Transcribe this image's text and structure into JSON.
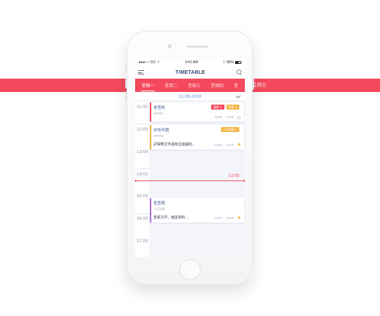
{
  "status": {
    "carrier": "●●●○○ GS",
    "time": "9:41 AM",
    "battery": "58%"
  },
  "header": {
    "title": "TIMETABLE"
  },
  "tabs": [
    {
      "label": "星期一",
      "active": true
    },
    {
      "label": "星期二",
      "active": false
    },
    {
      "label": "星期三",
      "active": false
    },
    {
      "label": "星期四",
      "active": false
    },
    {
      "label": "星",
      "active": false
    }
  ],
  "date": "11.06.2018",
  "hours": [
    "11:00",
    "12:00",
    "13:00",
    "14:00",
    "15:00",
    "16:00",
    "17:00"
  ],
  "now": "13:50",
  "cards": [
    {
      "title": "會查財",
      "subtitle": "台中市9",
      "badges": [
        {
          "label": "重要 ✕",
          "color": "#f4495c"
        },
        {
          "label": "待辦 ✕",
          "color": "#f3b43f"
        }
      ],
      "note": "",
      "time": "11:00 → 11:50",
      "marker": "circle",
      "accent": "#f4495c"
    },
    {
      "title": "去吃中國",
      "subtitle": "台中市9",
      "badges": [
        {
          "label": "公司會議 ✕",
          "color": "#f3b43f"
        }
      ],
      "note": "記得幫文件還有拉遊戲的...",
      "time": "12:00 → 13:10",
      "marker": "star",
      "accent": "#f3b43f"
    },
    {
      "title": "查查頭",
      "subtitle": "六巧文館",
      "badges": [],
      "note": "查看文件，面試資料...",
      "time": "14:30 → 15:40",
      "marker": "star",
      "accent": "#b06fe0"
    }
  ],
  "band_labels": [
    "星期一",
    "星期二",
    "星期三",
    "星期四",
    "星期五"
  ]
}
